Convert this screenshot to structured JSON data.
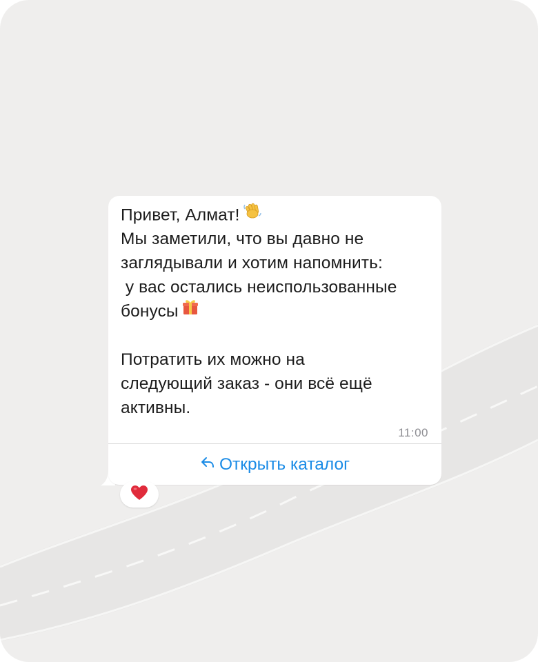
{
  "message": {
    "lines": [
      "Привет, Алмат!",
      "Мы заметили, что вы давно не",
      "заглядывали и хотим напомнить:",
      " у вас остались неиспользованные",
      "бонусы",
      "",
      "Потратить их можно на",
      "следующий заказ - они всё ещё",
      "активны."
    ],
    "time": "11:00"
  },
  "button": {
    "label": "Открыть каталог",
    "icon": "reply-arrow-icon"
  },
  "reaction": {
    "icon": "red-heart-icon"
  },
  "emojis": {
    "greeting": "waving-hand-icon",
    "bonus": "gift-icon"
  },
  "colors": {
    "background": "#efeeed",
    "bubble": "#ffffff",
    "link": "#1a8be6",
    "text": "#1c1c1c",
    "time": "#8e8e93"
  }
}
